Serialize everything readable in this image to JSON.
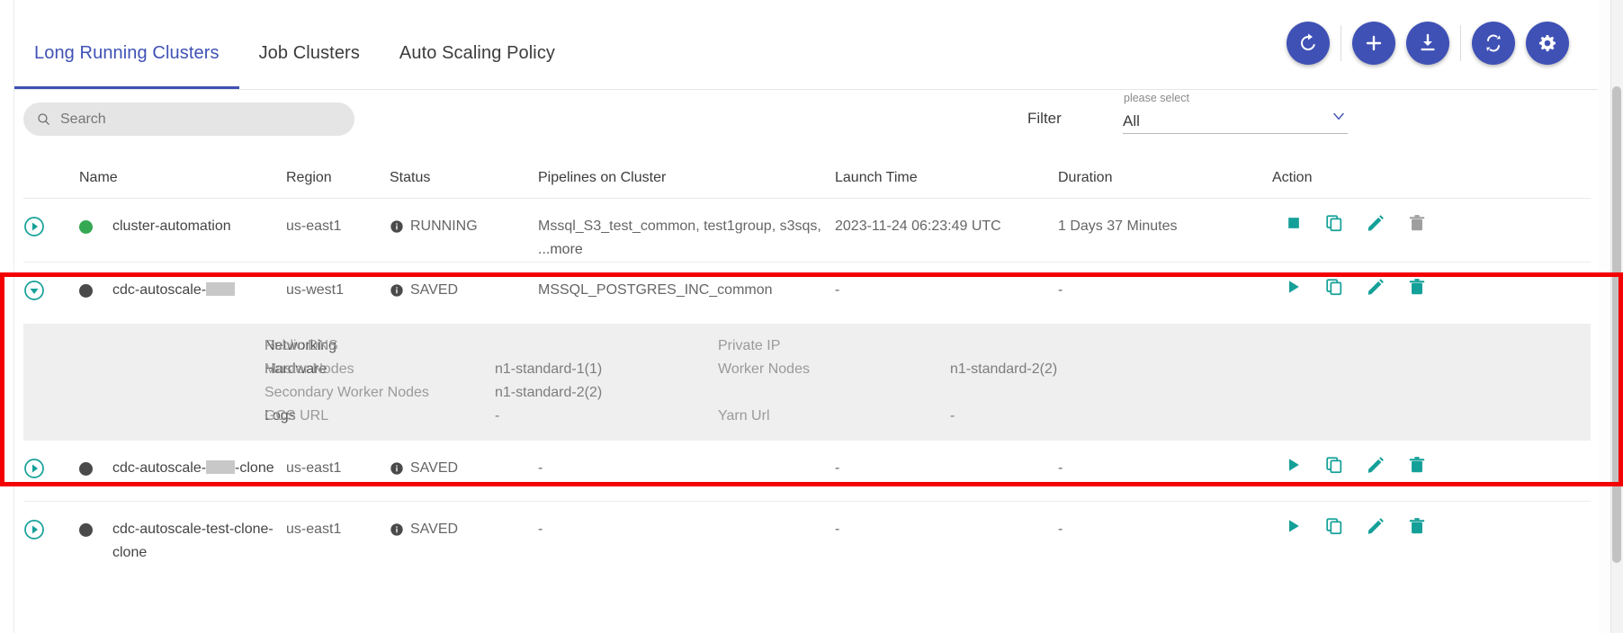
{
  "tabs": [
    {
      "label": "Long Running Clusters",
      "active": true
    },
    {
      "label": "Job Clusters",
      "active": false
    },
    {
      "label": "Auto Scaling Policy",
      "active": false
    }
  ],
  "header_actions": [
    {
      "name": "refresh-cluster-button",
      "icon": "refresh-icon"
    },
    {
      "name": "add-cluster-button",
      "icon": "plus-icon"
    },
    {
      "name": "download-button",
      "icon": "download-icon"
    },
    {
      "name": "sync-button",
      "icon": "sync-icon"
    },
    {
      "name": "settings-button",
      "icon": "gear-icon"
    }
  ],
  "search": {
    "value": "",
    "placeholder": "Search",
    "icon": "search-icon"
  },
  "filter": {
    "label": "Filter",
    "hint": "please select",
    "value": "All",
    "caret": "chevron-down-icon"
  },
  "table": {
    "columns": [
      "Name",
      "Region",
      "Status",
      "Pipelines on Cluster",
      "Launch Time",
      "Duration",
      "Action"
    ],
    "rows": [
      {
        "name": "cluster-automation",
        "name_redacted": false,
        "name_suffix": "",
        "status_dot": "green",
        "region": "us-east1",
        "status": "RUNNING",
        "pipelines": "Mssql_S3_test_common, test1group, s3sqs,",
        "pipelines_more": "...more",
        "launch_time": "2023-11-24 06:23:49 UTC",
        "duration": "1 Days 37 Minutes",
        "expanded": false,
        "actions": [
          "stop-icon",
          "copy-icon",
          "edit-icon",
          "delete-icon"
        ]
      },
      {
        "name": "cdc-autoscale-",
        "name_redacted": true,
        "name_suffix": "",
        "status_dot": "grey",
        "region": "us-west1",
        "status": "SAVED",
        "pipelines": "MSSQL_POSTGRES_INC_common",
        "pipelines_more": "",
        "launch_time": "-",
        "duration": "-",
        "expanded": true,
        "actions": [
          "play-icon",
          "copy-icon",
          "edit-icon",
          "delete-icon"
        ],
        "detail": {
          "networking_label": "Networking",
          "public_dns_label": "Public DNS",
          "public_dns_value": "",
          "private_ip_label": "Private IP",
          "private_ip_value": "",
          "hardware_label": "Hardware",
          "master_nodes_label": "Master Nodes",
          "master_nodes_value": "n1-standard-1(1)",
          "worker_nodes_label": "Worker Nodes",
          "worker_nodes_value": "n1-standard-2(2)",
          "secondary_worker_label": "Secondary Worker Nodes",
          "secondary_worker_value": "n1-standard-2(2)",
          "logs_label": "Logs",
          "gcs_url_label": "GCS URL",
          "gcs_url_value": "-",
          "yarn_url_label": "Yarn Url",
          "yarn_url_value": "-"
        }
      },
      {
        "name": "cdc-autoscale-",
        "name_redacted": true,
        "name_suffix": "-clone",
        "status_dot": "grey",
        "region": "us-east1",
        "status": "SAVED",
        "pipelines": "-",
        "pipelines_more": "",
        "launch_time": "-",
        "duration": "-",
        "expanded": false,
        "actions": [
          "play-icon",
          "copy-icon",
          "edit-icon",
          "delete-icon"
        ]
      },
      {
        "name": "cdc-autoscale-test-clone-clone",
        "name_redacted": false,
        "name_suffix": "",
        "status_dot": "grey",
        "region": "us-east1",
        "status": "SAVED",
        "pipelines": "-",
        "pipelines_more": "",
        "launch_time": "-",
        "duration": "-",
        "expanded": false,
        "actions": [
          "play-icon",
          "copy-icon",
          "edit-icon",
          "delete-icon"
        ]
      }
    ]
  },
  "colors": {
    "accent": "#3f51b5",
    "teal": "#14a098",
    "running_dot": "#34a853",
    "saved_dot": "#4a4a4a",
    "highlight_box": "#f40000"
  }
}
